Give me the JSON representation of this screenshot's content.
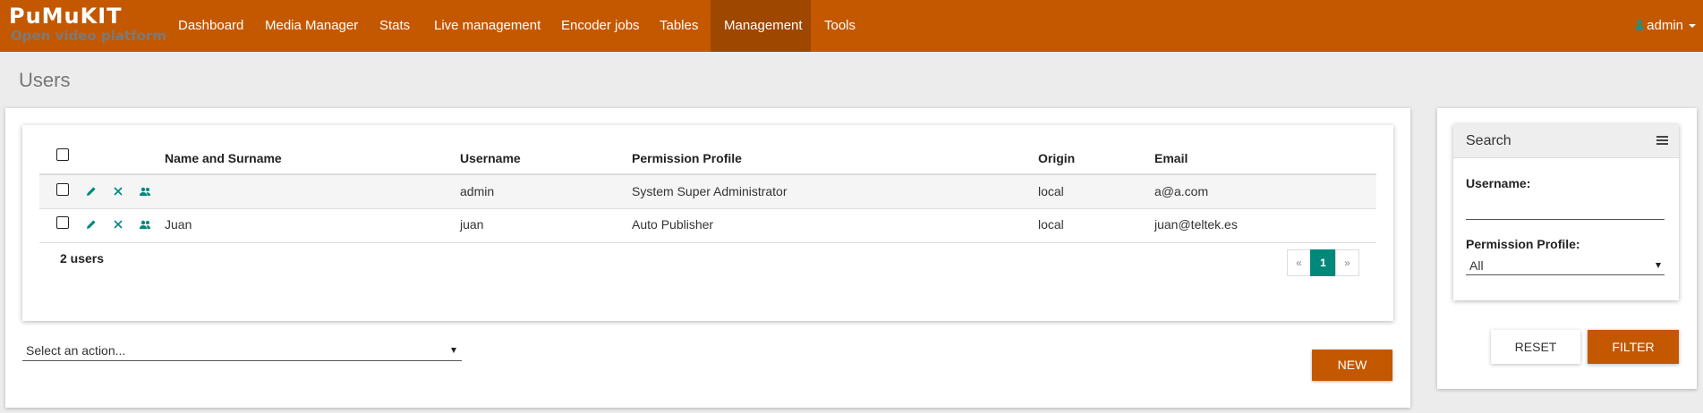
{
  "brand": {
    "logo_text": "PuMuKIT",
    "subtitle": "Open video platform",
    "color": "#c45800",
    "active_nav_color": "#9e4700",
    "accent": "#00897b"
  },
  "nav": {
    "items": [
      {
        "label": "Dashboard",
        "active": false
      },
      {
        "label": "Media Manager",
        "active": false
      },
      {
        "label": "Stats",
        "active": false
      },
      {
        "label": "Live management",
        "active": false
      },
      {
        "label": "Encoder jobs",
        "active": false
      },
      {
        "label": "Tables",
        "active": false
      },
      {
        "label": "Management",
        "active": true
      },
      {
        "label": "Tools",
        "active": false
      }
    ],
    "user": {
      "name": "admin",
      "icon": "person-icon"
    }
  },
  "page": {
    "title": "Users"
  },
  "table": {
    "columns": [
      "Name and Surname",
      "Username",
      "Permission Profile",
      "Origin",
      "Email"
    ],
    "row_icons": [
      "edit-icon",
      "delete-icon",
      "groups-icon"
    ],
    "rows": [
      {
        "name": "",
        "username": "admin",
        "profile": "System Super Administrator",
        "origin": "local",
        "email": "a@a.com"
      },
      {
        "name": "Juan",
        "username": "juan",
        "profile": "Auto Publisher",
        "origin": "local",
        "email": "juan@teltek.es"
      }
    ],
    "count_label": "2 users",
    "pagination": {
      "prev": "«",
      "current": "1",
      "next": "»"
    }
  },
  "actions": {
    "select_placeholder": "Select an action...",
    "new_label": "NEW"
  },
  "search": {
    "title": "Search",
    "username_label": "Username:",
    "username_value": "",
    "profile_label": "Permission Profile:",
    "profile_value": "All",
    "reset_label": "RESET",
    "filter_label": "FILTER"
  }
}
